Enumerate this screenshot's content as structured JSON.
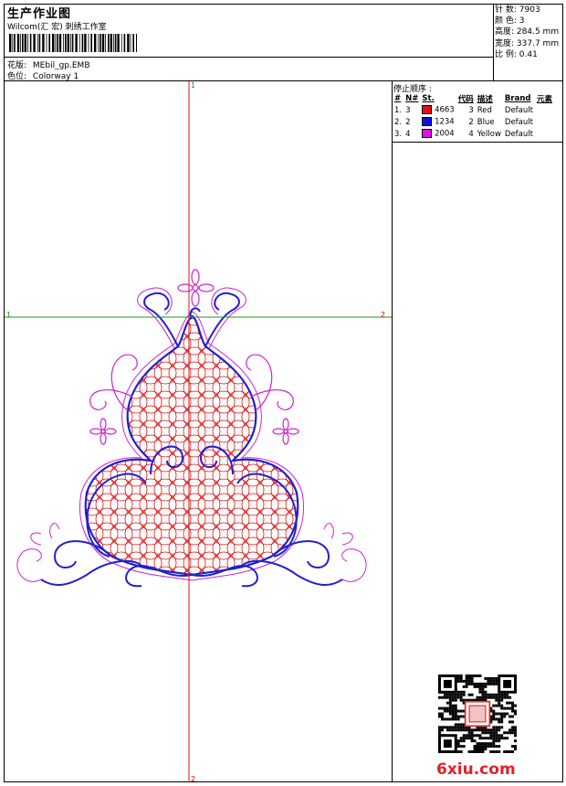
{
  "header": {
    "title": "生产作业图",
    "subtitle": "Wilcom(汇 宏) 刺绣工作室",
    "design_label": "花版:",
    "design_value": "MEbil_gp.EMB",
    "colorway_label": "色位:",
    "colorway_value": "Colorway 1"
  },
  "stats": [
    {
      "label": "针 数:",
      "value": "7903"
    },
    {
      "label": "颜 色:",
      "value": "3"
    },
    {
      "label": "高度:",
      "value": "284.5 mm"
    },
    {
      "label": "宽度:",
      "value": "337.7 mm"
    },
    {
      "label": "比 例:",
      "value": "0.41"
    }
  ],
  "stop_sequence": {
    "title": "停止顺序 :",
    "headers": [
      "#",
      "N#",
      "St.",
      "代码",
      "描述",
      "Brand",
      "元素"
    ],
    "rows": [
      {
        "num": "1.",
        "n": "3",
        "color": "#e01010",
        "st": "4663",
        "code": "3",
        "desc": "Red",
        "brand": "Default"
      },
      {
        "num": "2.",
        "n": "2",
        "color": "#1010e0",
        "st": "1234",
        "code": "2",
        "desc": "Blue",
        "brand": "Default"
      },
      {
        "num": "3.",
        "n": "4",
        "color": "#e010e0",
        "st": "2004",
        "code": "4",
        "desc": "Yellow",
        "brand": "Default"
      }
    ]
  },
  "axes": {
    "v_top": "1",
    "v_bottom": "2",
    "h_left": "1",
    "h_right": "2"
  },
  "colors": {
    "red": "#e01010",
    "blue": "#2020d0",
    "magenta": "#d020d0",
    "green": "#1a9a1a"
  },
  "watermark": "6xiu.com"
}
